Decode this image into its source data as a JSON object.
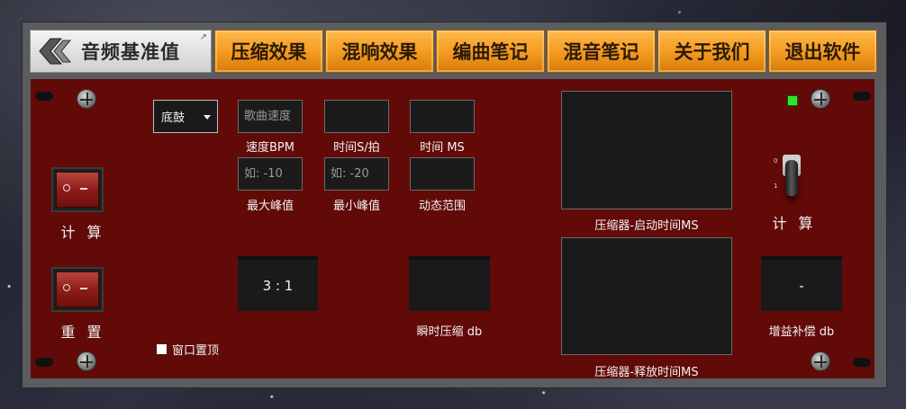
{
  "logo": {
    "title": "音频基准值",
    "corner_glyph": "↗"
  },
  "tabs": [
    {
      "label": "压缩效果"
    },
    {
      "label": "混响效果"
    },
    {
      "label": "编曲笔记"
    },
    {
      "label": "混音笔记"
    },
    {
      "label": "关于我们"
    },
    {
      "label": "退出软件"
    }
  ],
  "left_controls": {
    "calc_label": "计 算",
    "reset_label": "重 置",
    "always_on_top_label": "窗口置顶"
  },
  "dropdown": {
    "selected": "底鼓"
  },
  "inputs": {
    "tempo": {
      "placeholder": "歌曲速度",
      "label": "速度BPM"
    },
    "time_s": {
      "value": "",
      "label": "时间S/拍"
    },
    "time_ms": {
      "value": "",
      "label": "时间 MS"
    },
    "max_peak": {
      "placeholder": "如: -10",
      "label": "最大峰值"
    },
    "min_peak": {
      "placeholder": "如: -20",
      "label": "最小峰值"
    },
    "dynamic_range": {
      "value": "",
      "label": "动态范围"
    }
  },
  "displays": {
    "ratio": {
      "value": "3 : 1"
    },
    "instant_comp": {
      "value": "",
      "label": "瞬时压缩 db"
    },
    "attack": {
      "value": "",
      "label": "压缩器-启动时间MS"
    },
    "release": {
      "value": "",
      "label": "压缩器-释放时间MS"
    },
    "makeup_gain": {
      "value": "-",
      "label": "增益补偿 db"
    }
  },
  "right_controls": {
    "calc_label": "计 算",
    "toggle_top": "0",
    "toggle_bottom": "1",
    "led_color": "#2ee52e"
  },
  "colors": {
    "panel": "#620a08",
    "tab_accent": "#f29a1e"
  }
}
